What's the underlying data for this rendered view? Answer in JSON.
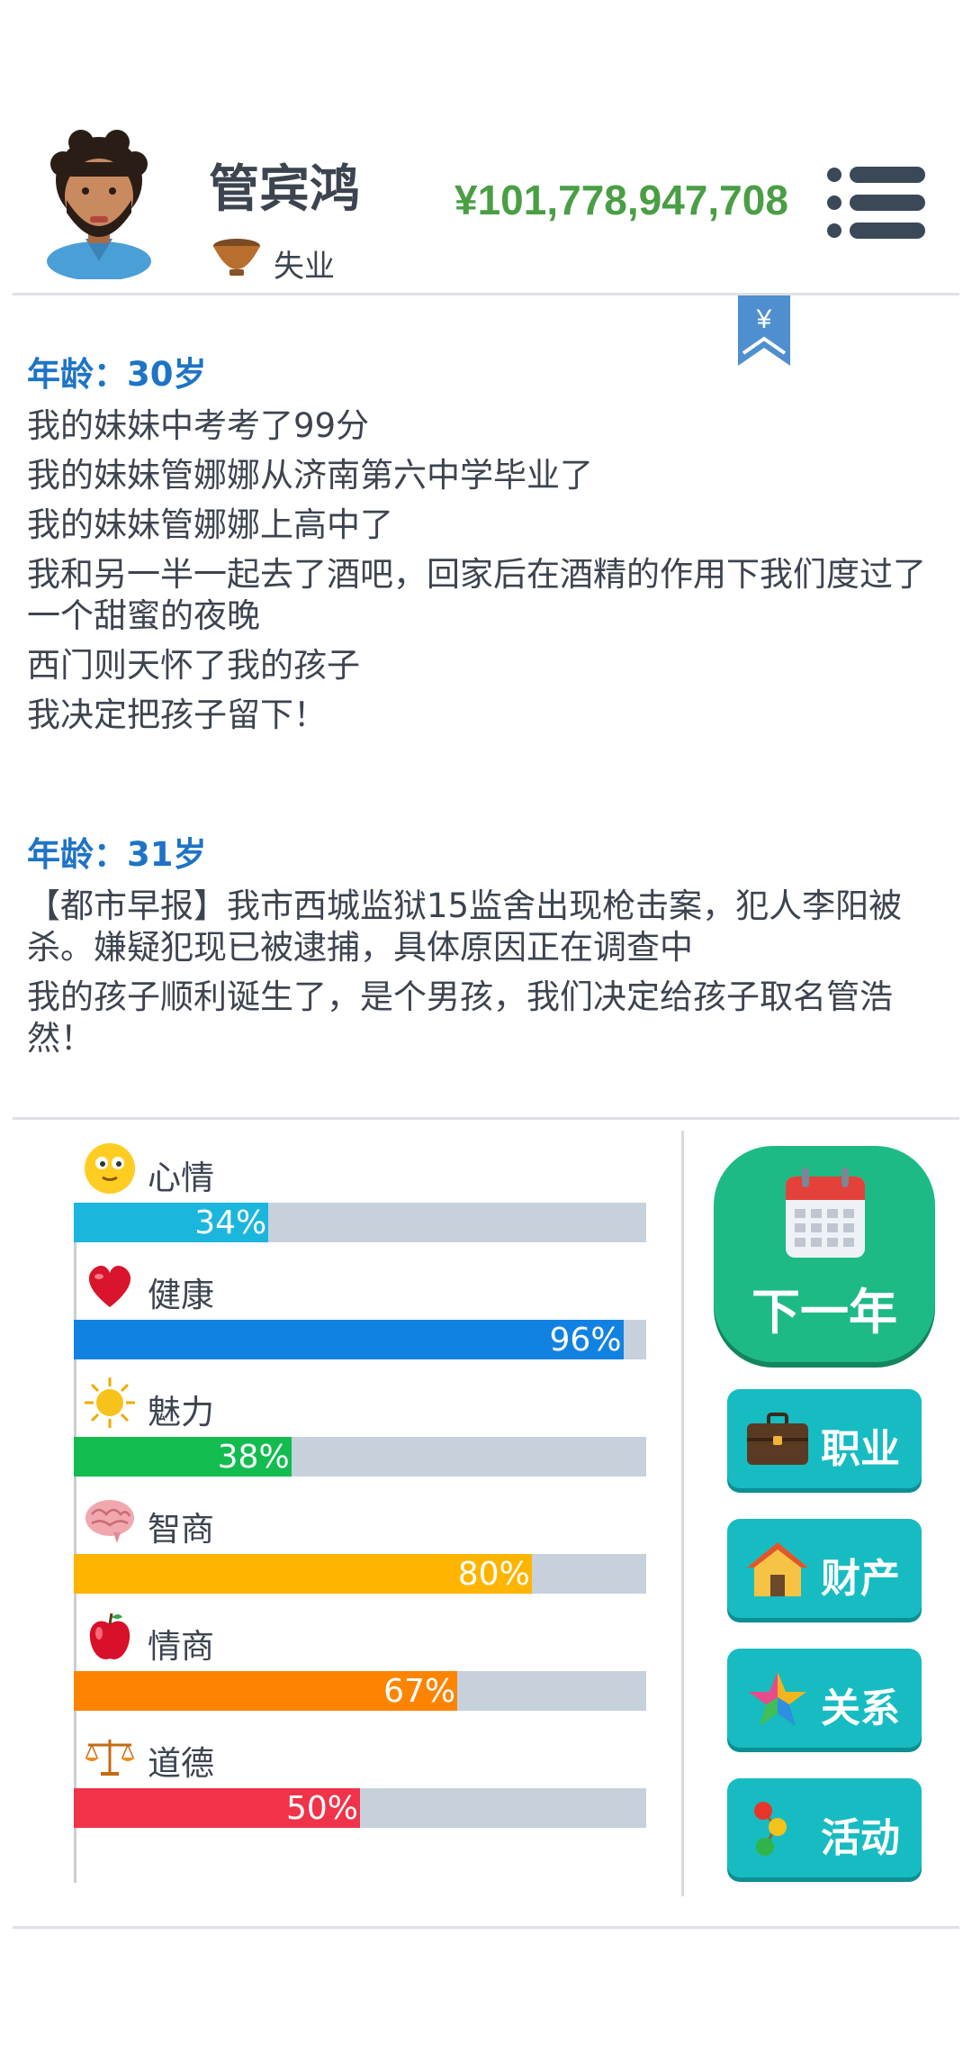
{
  "header": {
    "name": "管宾鸿",
    "job": "失业",
    "money": "¥101,778,947,708"
  },
  "log": [
    {
      "age": "年龄：30岁",
      "entries": [
        "我的妹妹中考考了99分",
        "我的妹妹管娜娜从济南第六中学毕业了",
        "我的妹妹管娜娜上高中了",
        "我和另一半一起去了酒吧，回家后在酒精的作用下我们度过了一个甜蜜的夜晚",
        "西门则天怀了我的孩子",
        "我决定把孩子留下！"
      ]
    },
    {
      "age": "年龄：31岁",
      "entries": [
        "【都市早报】我市西城监狱15监舍出现枪击案，犯人李阳被杀。嫌疑犯现已被逮捕，具体原因正在调查中",
        "我的孩子顺利诞生了，是个男孩，我们决定给孩子取名管浩然！"
      ]
    }
  ],
  "stats": [
    {
      "label": "心情",
      "value": 34,
      "text": "34%",
      "color": "#1bb6dd",
      "icon": "smiley-icon"
    },
    {
      "label": "健康",
      "value": 96,
      "text": "96%",
      "color": "#1282e2",
      "icon": "heart-icon"
    },
    {
      "label": "魅力",
      "value": 38,
      "text": "38%",
      "color": "#12bc4f",
      "icon": "sun-icon"
    },
    {
      "label": "智商",
      "value": 80,
      "text": "80%",
      "color": "#ffb400",
      "icon": "brain-icon"
    },
    {
      "label": "情商",
      "value": 67,
      "text": "67%",
      "color": "#fd8401",
      "icon": "apple-icon"
    },
    {
      "label": "道德",
      "value": 50,
      "text": "50%",
      "color": "#f1334a",
      "icon": "scales-icon"
    }
  ],
  "actions": {
    "next_year": "下一年",
    "career": "职业",
    "property": "财产",
    "relations": "关系",
    "activities": "活动"
  }
}
